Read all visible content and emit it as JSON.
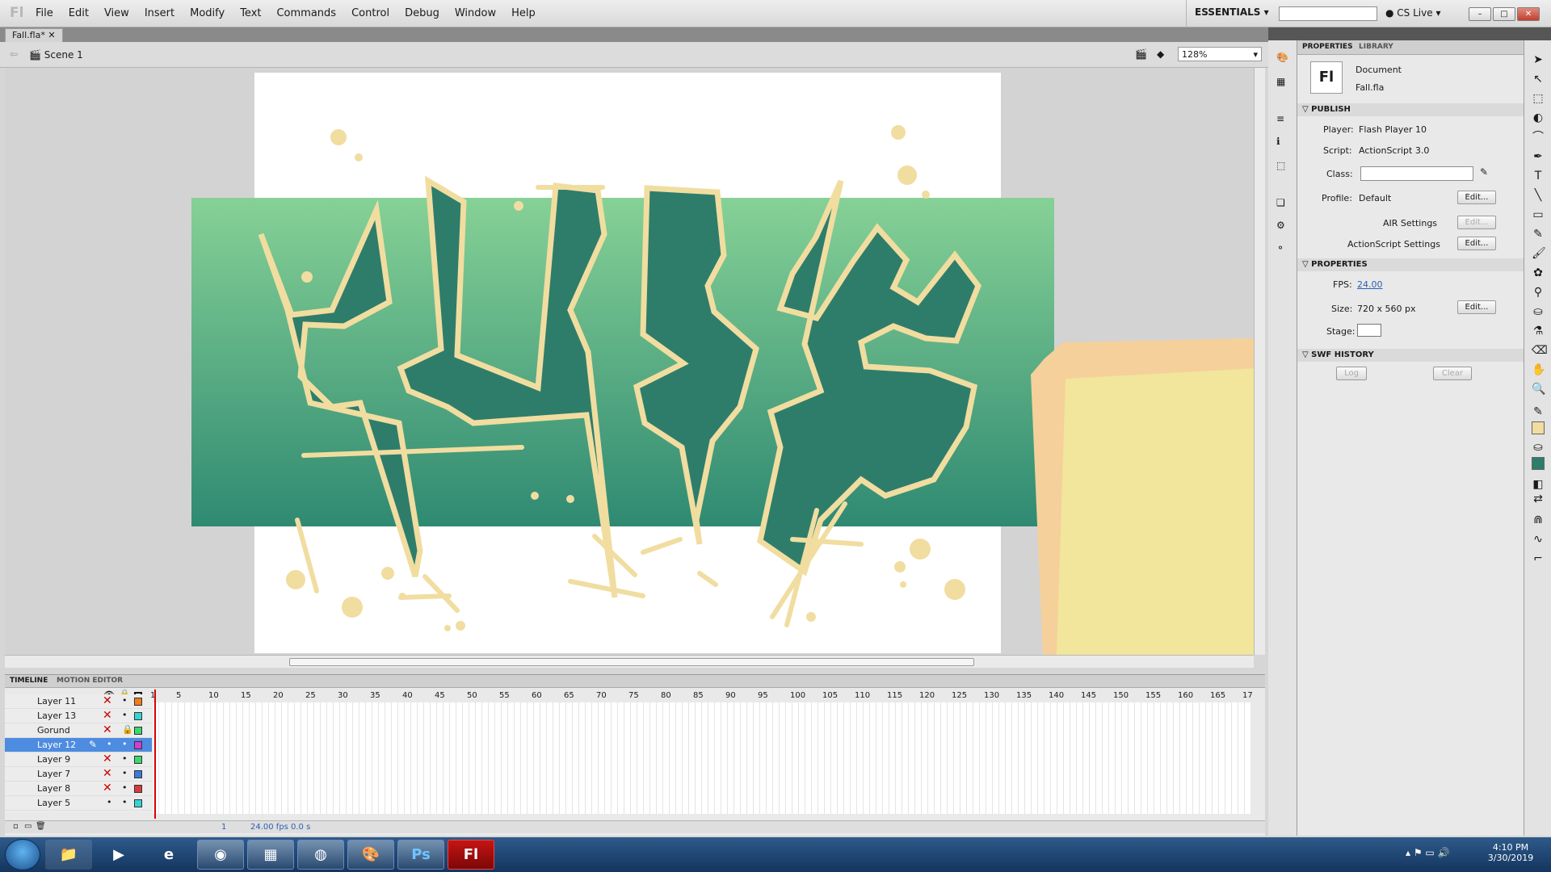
{
  "app": {
    "logo": "Fl"
  },
  "menu": [
    "File",
    "Edit",
    "View",
    "Insert",
    "Modify",
    "Text",
    "Commands",
    "Control",
    "Debug",
    "Window",
    "Help"
  ],
  "workspace": "ESSENTIALS",
  "cslive": "CS Live",
  "document_tab": "Fall.fla*",
  "editbar": {
    "scene": "Scene 1",
    "zoom": "128%"
  },
  "timeline": {
    "tabs": [
      "TIMELINE",
      "MOTION EDITOR"
    ],
    "layers": [
      {
        "name": "Layer 11",
        "color": "#f07f1a",
        "selected": false
      },
      {
        "name": "Layer 13",
        "color": "#35d4d4",
        "selected": false
      },
      {
        "name": "Gorund",
        "color": "#3ad86e",
        "selected": false
      },
      {
        "name": "Layer 12",
        "color": "#d43ad4",
        "selected": true
      },
      {
        "name": "Layer 9",
        "color": "#3ad86e",
        "selected": false
      },
      {
        "name": "Layer 7",
        "color": "#3a7ad8",
        "selected": false
      },
      {
        "name": "Layer 8",
        "color": "#d83a3a",
        "selected": false
      },
      {
        "name": "Layer 5",
        "color": "#35d4d4",
        "selected": false
      }
    ],
    "ruler": [
      "1",
      "5",
      "10",
      "15",
      "20",
      "25",
      "30",
      "35",
      "40",
      "45",
      "50",
      "55",
      "60",
      "65",
      "70",
      "75",
      "80",
      "85",
      "90",
      "95",
      "100",
      "105",
      "110",
      "115",
      "120",
      "125",
      "130",
      "135",
      "140",
      "145",
      "150",
      "155",
      "160",
      "165",
      "17"
    ],
    "footer": {
      "frame": "1",
      "fps": "24.00 fps",
      "time": "0.0 s"
    }
  },
  "properties": {
    "tabs": [
      "PROPERTIES",
      "LIBRARY"
    ],
    "doc_icon": "Fl",
    "doc_label": "Document",
    "doc_name": "Fall.fla",
    "publish_header": "PUBLISH",
    "player_label": "Player:",
    "player": "Flash Player 10",
    "script_label": "Script:",
    "script": "ActionScript 3.0",
    "class_label": "Class:",
    "profile_label": "Profile:",
    "profile": "Default",
    "edit": "Edit...",
    "air_settings": "AIR Settings",
    "as_settings": "ActionScript Settings",
    "props_header": "PROPERTIES",
    "fps_label": "FPS:",
    "fps": "24.00",
    "size_label": "Size:",
    "size": "720 x 560 px",
    "stage_label": "Stage:",
    "swf_header": "SWF HISTORY",
    "log": "Log",
    "clear": "Clear"
  },
  "taskbar": {
    "ps": "Ps",
    "fl": "Fl",
    "time": "4:10 PM",
    "date": "3/30/2019"
  },
  "colors": {
    "bg_green_top": "#86d196",
    "bg_green_bottom": "#2f8a72",
    "letter": "#2e7d6b",
    "outline": "#f1dda0",
    "sand": "#f2e59c",
    "sand_edge": "#f5d09a"
  }
}
